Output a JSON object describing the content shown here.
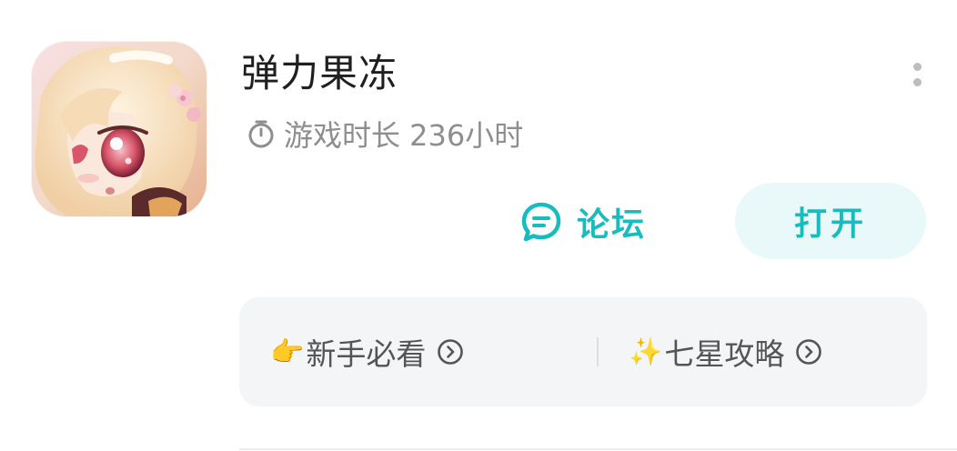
{
  "game": {
    "title": "弹力果冻",
    "playtime": "游戏时长 236小时"
  },
  "actions": {
    "forum_label": "论坛",
    "open_label": "打开"
  },
  "shortcuts": [
    {
      "emoji": "👉",
      "label": "新手必看"
    },
    {
      "emoji": "✨",
      "label": "七星攻略"
    }
  ],
  "icons": {
    "more": "more-vertical-icon",
    "timer": "stopwatch-icon",
    "forum": "chat-bubble-icon",
    "chevron": "chevron-right-circle-icon"
  },
  "colors": {
    "accent": "#17bcbe",
    "accent_bg": "#e9f8f8",
    "title": "#1f1f1f",
    "secondary": "#8e8e8e",
    "panel_bg": "#f4f5f7"
  }
}
